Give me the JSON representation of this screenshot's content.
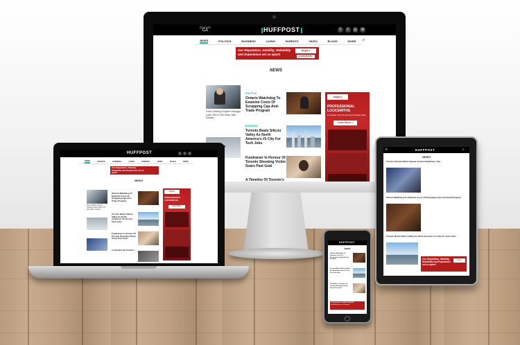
{
  "site": {
    "logo": "HUFFPOST",
    "edition_small": "CA",
    "edition_label": "EDITION",
    "social_icons": [
      "facebook-icon",
      "twitter-icon",
      "instagram-icon",
      "email-icon"
    ]
  },
  "nav": {
    "items": [
      "NEWS",
      "POLITICS",
      "BUSINESS",
      "LIVING",
      "PARENTS",
      "VIDEO",
      "BLOGS",
      "MORE"
    ],
    "active": "NEWS",
    "search_icon": "search-icon"
  },
  "ad_banner": {
    "text": "Our Reputation, Stability, Reliability and Experience set us apart!",
    "brand": "Angie's LOCKSMITHS",
    "button": "LEARN MORE >"
  },
  "section_title": "NEWS",
  "articles": [
    {
      "tag": "",
      "title": "Ontario Watchdog To Examine Costs Of Scrapping Cap-And-Trade Program",
      "caption": "Ford's Mulling Tougher Handgun Laws, But It's No Easy Task: Insiders"
    },
    {
      "tag": "Politics",
      "title": "Ontario Watchdog To Examine Costs Of Scrapping Cap-And-Trade Program"
    },
    {
      "tag": "Business",
      "title": "Toronto Beats Silicon Valley As North America's #1 City For Tech Jobs"
    },
    {
      "tag": "",
      "title": "Fundraiser In Honour Of Toronto Shooting Victim Soars Past Goal"
    },
    {
      "tag": "",
      "title": "A Timeline Of Toronto's"
    }
  ],
  "side_ad": {
    "brand": "Angie's LOCKSMITHS",
    "headline": "PROFESSIONAL LOCKSMITHS",
    "sub": "in Greater Toronto and Surrounding areas",
    "button": "Learn More >"
  },
  "tablet": {
    "headlines": [
      "Toronto Shooter Didn't Appear Armed, Neighbours Say",
      "Ontario Watchdog To Examine Costs Of Scrapping Cap-And-Trade Program",
      "Toronto Beats Silicon Valley As North America's #1 City For Tech Jobs"
    ]
  },
  "colors": {
    "accent": "#0dbe98",
    "ad_red": "#b71c1c",
    "header": "#000000"
  }
}
